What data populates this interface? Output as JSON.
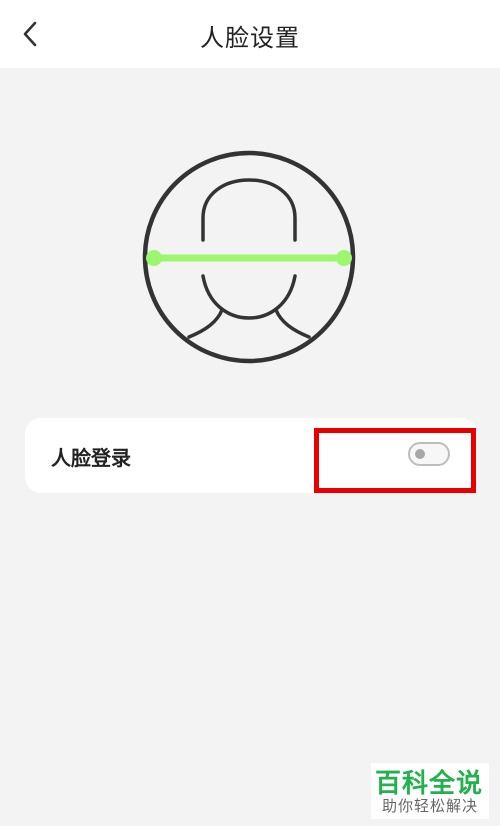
{
  "header": {
    "title": "人脸设置"
  },
  "face_login": {
    "label": "人脸登录",
    "enabled": false
  },
  "watermark": {
    "title": "百科全说",
    "subtitle": "助你轻松解决"
  },
  "colors": {
    "scan_line": "#9cf66e",
    "highlight": "#e90000",
    "watermark": "#23b14d"
  }
}
